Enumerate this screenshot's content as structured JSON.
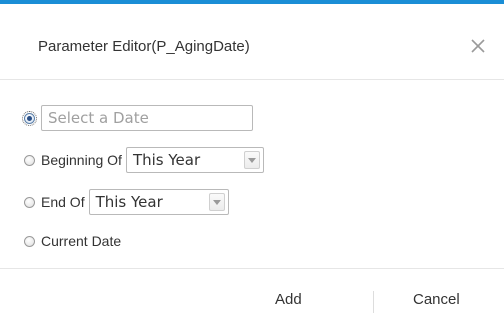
{
  "dialog": {
    "title": "Parameter Editor(P_AgingDate)",
    "accent_color": "#1a8ed6",
    "close_icon": "close-icon"
  },
  "options": {
    "date": {
      "selected": true,
      "placeholder": "Select a Date",
      "value": ""
    },
    "beginning_of": {
      "selected": false,
      "label": "Beginning Of",
      "select_value": "This Year"
    },
    "end_of": {
      "selected": false,
      "label": "End Of",
      "select_value": "This Year"
    },
    "current_date": {
      "selected": false,
      "label": "Current Date"
    }
  },
  "footer": {
    "add_label": "Add",
    "cancel_label": "Cancel"
  }
}
